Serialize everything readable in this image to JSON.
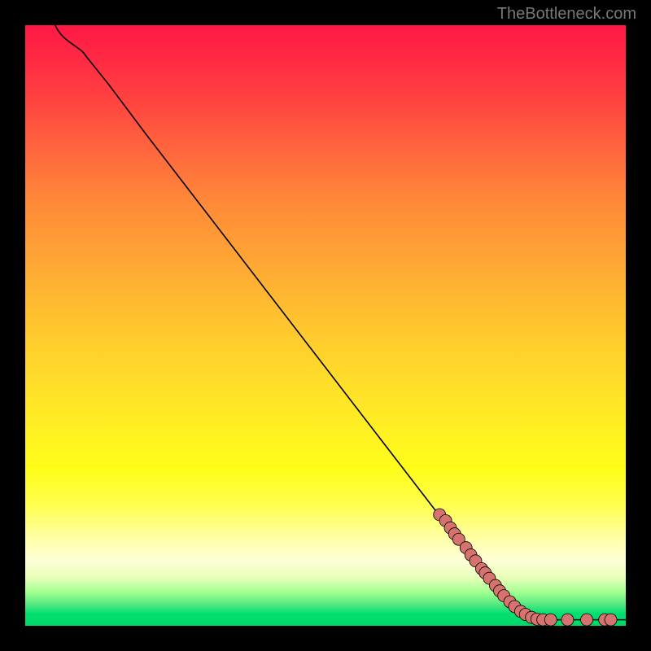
{
  "watermark": "TheBottleneck.com",
  "chart_data": {
    "type": "line",
    "title": "",
    "xlabel": "",
    "ylabel": "",
    "xlim": [
      0,
      100
    ],
    "ylim": [
      0,
      100
    ],
    "curve": [
      {
        "x": 5,
        "y": 100
      },
      {
        "x": 7,
        "y": 98
      },
      {
        "x": 10,
        "y": 95
      },
      {
        "x": 14,
        "y": 90
      },
      {
        "x": 20,
        "y": 82
      },
      {
        "x": 30,
        "y": 69
      },
      {
        "x": 40,
        "y": 56
      },
      {
        "x": 50,
        "y": 43
      },
      {
        "x": 60,
        "y": 30
      },
      {
        "x": 70,
        "y": 17
      },
      {
        "x": 78,
        "y": 7
      },
      {
        "x": 83,
        "y": 2.5
      },
      {
        "x": 86,
        "y": 1
      },
      {
        "x": 100,
        "y": 1
      }
    ],
    "points": [
      {
        "x": 69,
        "y": 18.5
      },
      {
        "x": 70,
        "y": 17.5
      },
      {
        "x": 70.8,
        "y": 16.3
      },
      {
        "x": 71.5,
        "y": 15.3
      },
      {
        "x": 72.2,
        "y": 14.4
      },
      {
        "x": 73.4,
        "y": 13.0
      },
      {
        "x": 74.2,
        "y": 11.8
      },
      {
        "x": 75.0,
        "y": 10.8
      },
      {
        "x": 76.0,
        "y": 9.5
      },
      {
        "x": 76.6,
        "y": 8.8
      },
      {
        "x": 77.3,
        "y": 7.9
      },
      {
        "x": 78.3,
        "y": 6.7
      },
      {
        "x": 79.0,
        "y": 5.8
      },
      {
        "x": 79.7,
        "y": 5.0
      },
      {
        "x": 80.7,
        "y": 4.0
      },
      {
        "x": 81.5,
        "y": 3.2
      },
      {
        "x": 82.5,
        "y": 2.4
      },
      {
        "x": 83.3,
        "y": 1.9
      },
      {
        "x": 84.3,
        "y": 1.4
      },
      {
        "x": 85.2,
        "y": 1.1
      },
      {
        "x": 86.2,
        "y": 1.0
      },
      {
        "x": 87.5,
        "y": 1.0
      },
      {
        "x": 90.3,
        "y": 1.0
      },
      {
        "x": 93.5,
        "y": 1.0
      },
      {
        "x": 96.5,
        "y": 1.0
      },
      {
        "x": 97.5,
        "y": 1.0
      }
    ],
    "point_color": "#d6736f",
    "point_border": "#000000"
  }
}
